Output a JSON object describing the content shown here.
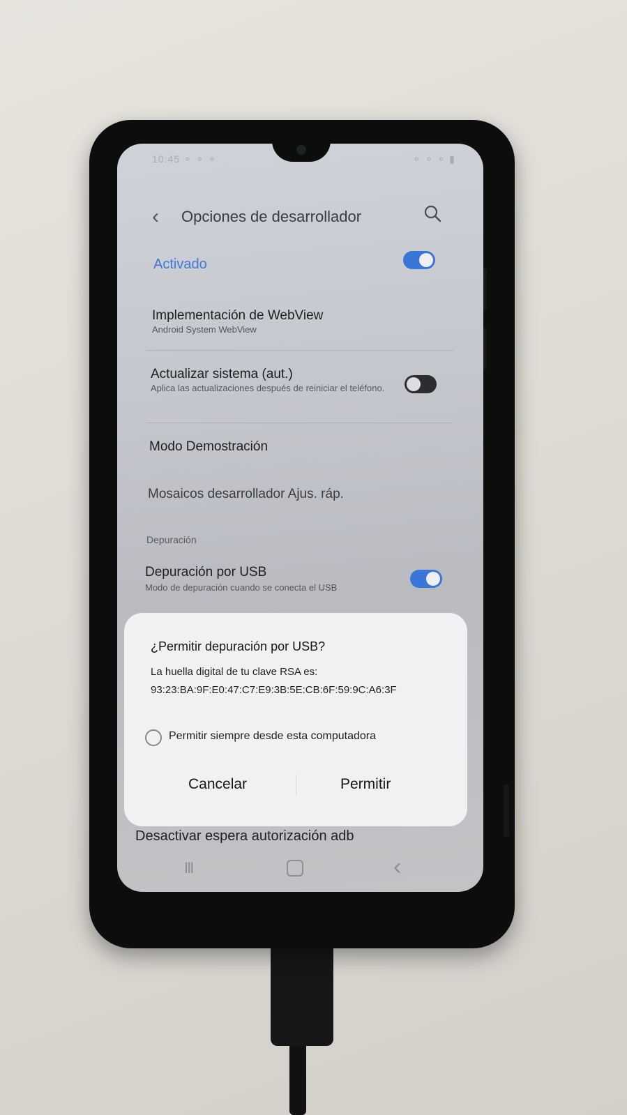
{
  "status_bar": {
    "left": "10:45 ⚬ ⚬ ⚬",
    "right": "⚬ ⚬ ⚬ ▮"
  },
  "header": {
    "back_glyph": "‹",
    "title": "Opciones de desarrollador"
  },
  "master_toggle": {
    "label": "Activado",
    "on": true
  },
  "settings": {
    "webview": {
      "title": "Implementación de WebView",
      "subtitle": "Android System WebView"
    },
    "auto_update": {
      "title": "Actualizar sistema (aut.)",
      "subtitle": "Aplica las actualizaciones después de reiniciar el teléfono.",
      "on": false
    },
    "demo": {
      "title": "Modo Demostración"
    },
    "tiles": {
      "title": "Mosaicos desarrollador Ajus. ráp."
    },
    "section_debug": "Depuración",
    "usb_debug": {
      "title": "Depuración por USB",
      "subtitle": "Modo de depuración cuando se conecta el USB",
      "on": true
    },
    "adb_auth": {
      "title": "Desactivar espera autorización adb"
    }
  },
  "dialog": {
    "title": "¿Permitir depuración por USB?",
    "body_line1": "La huella digital de tu clave RSA es:",
    "fingerprint": "93:23:BA:9F:E0:47:C7:E9:3B:5E:CB:6F:59:9C:A6:3F",
    "checkbox_label": "Permitir siempre desde esta computadora",
    "cancel_label": "Cancelar",
    "allow_label": "Permitir"
  },
  "nav_bar": {
    "recents": "III",
    "back": "‹"
  },
  "colors": {
    "accent": "#3a76d8",
    "dialog_bg": "#f1f1f3"
  }
}
